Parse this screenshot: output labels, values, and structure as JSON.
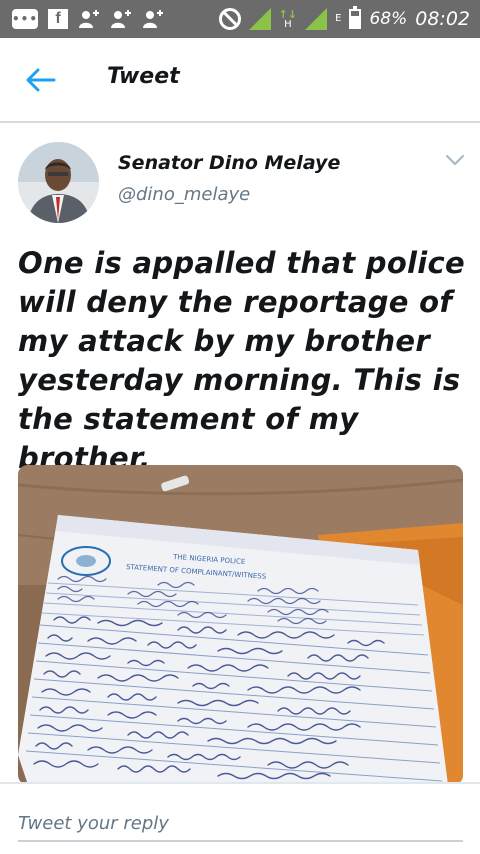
{
  "status_bar": {
    "message_icon": "message-bubble-icon",
    "facebook_icon": "facebook-icon",
    "person_icon": "person-add-icon",
    "battery_percent": "68%",
    "battery_level": 0.68,
    "time": "08:02",
    "network_type": "H",
    "sim_label": "E"
  },
  "app_bar": {
    "title": "Tweet",
    "back_icon": "arrow-left-icon",
    "accent_color": "#1da1f2"
  },
  "tweet": {
    "author_name": "Senator Dino Melaye",
    "author_handle": "@dino_melaye",
    "text": "One is appalled that police will deny the reportage of my attack by my brother yesterday morning. This is the statement of my brother.",
    "more_icon": "chevron-down-icon"
  },
  "photo": {
    "form_title_1": "THE NIGERIA POLICE",
    "form_title_2": "STATEMENT OF COMPLAINANT/WITNESS"
  },
  "reply": {
    "placeholder": "Tweet your reply"
  }
}
